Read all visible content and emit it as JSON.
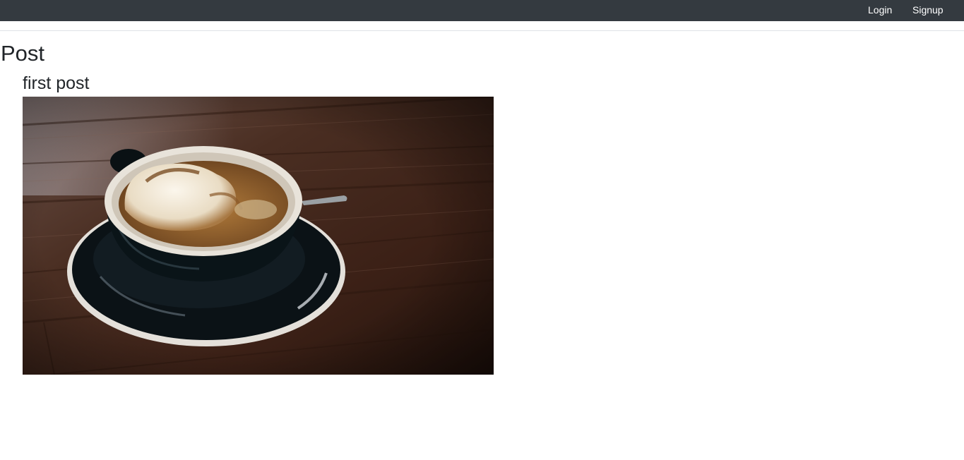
{
  "nav": {
    "login_label": "Login",
    "signup_label": "Signup"
  },
  "page": {
    "title": "Post"
  },
  "posts": [
    {
      "title": "first post",
      "image_subject": "coffee-cup-photo"
    }
  ],
  "colors": {
    "navbar_bg": "#343a40",
    "text": "#212529",
    "nav_text": "#ffffff"
  }
}
